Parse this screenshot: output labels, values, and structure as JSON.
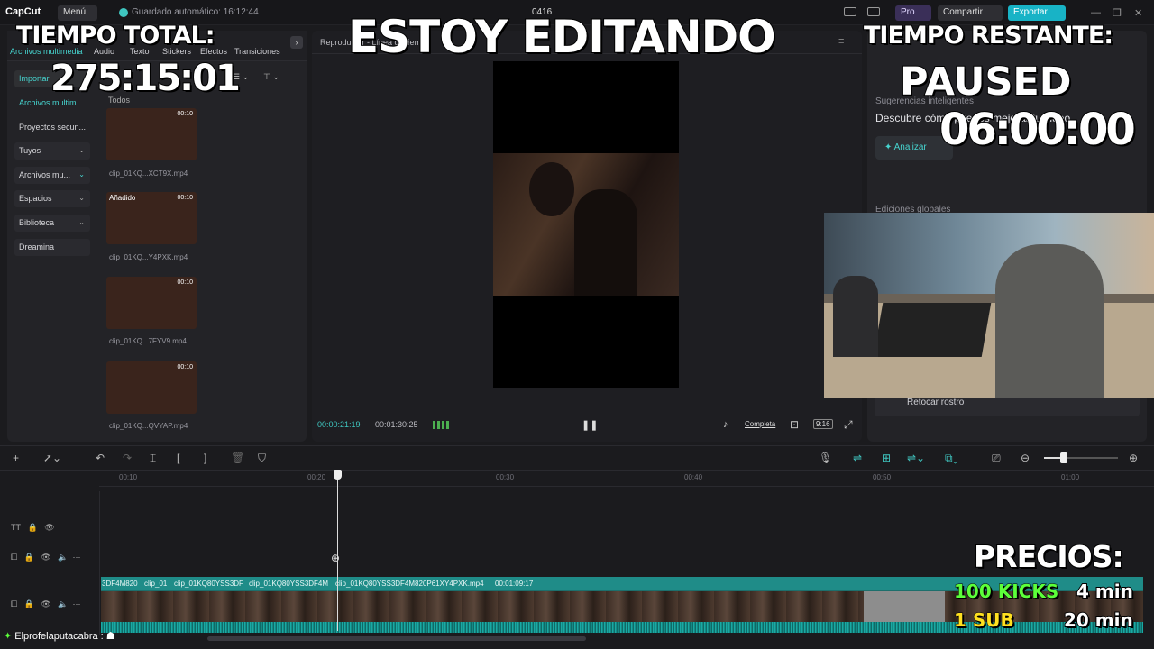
{
  "titlebar": {
    "app": "CapCut",
    "menu": "Menú",
    "autosave": "Guardado automático: 16:12:44",
    "project": "0416",
    "pro": "Pro",
    "share": "Compartir",
    "export": "Exportar"
  },
  "media": {
    "tabs": [
      "Archivos multimedia",
      "Audio",
      "Texto",
      "Stickers",
      "Efectos",
      "Transiciones"
    ],
    "sidebar": [
      {
        "label": "Importar"
      },
      {
        "label": "Archivos multim..."
      },
      {
        "label": "Proyectos secun..."
      },
      {
        "label": "Tuyos"
      },
      {
        "label": "Archivos mu..."
      },
      {
        "label": "Espacios"
      },
      {
        "label": "Biblioteca"
      },
      {
        "label": "Dreamina"
      }
    ],
    "filter": "Todos",
    "clips": [
      {
        "name": "clip_01KQ...XCT9X.mp4",
        "duration": "00:10",
        "added": ""
      },
      {
        "name": "clip_01KQ...Y4PXK.mp4",
        "duration": "00:10",
        "added": "Añadido"
      },
      {
        "name": "clip_01KQ...7FYV9.mp4",
        "duration": "00:10",
        "added": ""
      },
      {
        "name": "clip_01KQ...QVYAP.mp4",
        "duration": "00:10",
        "added": ""
      }
    ]
  },
  "player": {
    "title": "Reproductor - Línea de tiempo",
    "current": "00:00:21:19",
    "total": "00:01:30:25",
    "full": "Completa",
    "ratio": "9:16"
  },
  "details": {
    "suggestions_title": "Sugerencias inteligentes",
    "suggestions_text": "Descubre cómo puedes mejorar tu video",
    "analyze": "Analizar",
    "global_edits": "Ediciones globales",
    "retouch": "Retocar rostro"
  },
  "timeline": {
    "ticks": [
      "00:10",
      "00:20",
      "00:30",
      "00:40",
      "00:50",
      "01:00"
    ],
    "clip_labels": [
      "3DF4M820",
      "clip_01",
      "clip_01KQ80YSS3DF",
      "clip_01KQ80YSS3DF4M",
      "clip_01KQ80YSS3DF4M820P61XY4PXK.mp4",
      "00:01:09:17"
    ]
  },
  "chat": {
    "line": "Elprofelaputacabra :"
  },
  "overlay": {
    "total_label": "TIEMPO TOTAL:",
    "total_value": "275:15:01",
    "center": "ESTOY EDITANDO",
    "remain_label": "TIEMPO RESTANTE:",
    "paused": "PAUSED",
    "remain_value": "06:00:00",
    "prices_label": "PRECIOS:",
    "price1_name": "100 KICKS",
    "price1_time": "4 min",
    "price2_name": "1 SUB",
    "price2_time": "20 min"
  },
  "colors": {
    "accent": "#3fc6c0",
    "export": "#18b3c6",
    "kicks": "#5cff3a",
    "sub": "#ffe020"
  }
}
